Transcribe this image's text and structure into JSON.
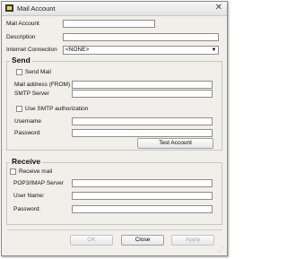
{
  "window": {
    "title": "Mail Account",
    "close_glyph": "✕",
    "icon": "mail-app-icon"
  },
  "account": {
    "mail_account_label": "Mail Account",
    "mail_account_value": "",
    "description_label": "Description",
    "description_value": "",
    "internet_connection_label": "Internet Connection",
    "internet_connection_value": "<NONE>"
  },
  "send": {
    "legend": "Send",
    "send_mail_label": "Send Mail",
    "send_mail_checked": false,
    "mail_from_label": "Mail address (FROM)",
    "mail_from_value": "",
    "smtp_server_label": "SMTP Server",
    "smtp_server_value": "",
    "smtp_auth_label": "Use SMTP authorization",
    "smtp_auth_checked": false,
    "username_label": "Username",
    "username_value": "",
    "password_label": "Password",
    "password_value": "",
    "test_button": "Test Account"
  },
  "receive": {
    "legend": "Receive",
    "receive_mail_label": "Receive mail",
    "receive_mail_checked": false,
    "server_label": "POP3/IMAP Server",
    "server_value": "",
    "user_name_label": "User Name:",
    "user_name_value": "",
    "password_label": "Password:",
    "password_value": ""
  },
  "footer": {
    "ok": "OK",
    "close": "Close",
    "apply": "Apply"
  }
}
